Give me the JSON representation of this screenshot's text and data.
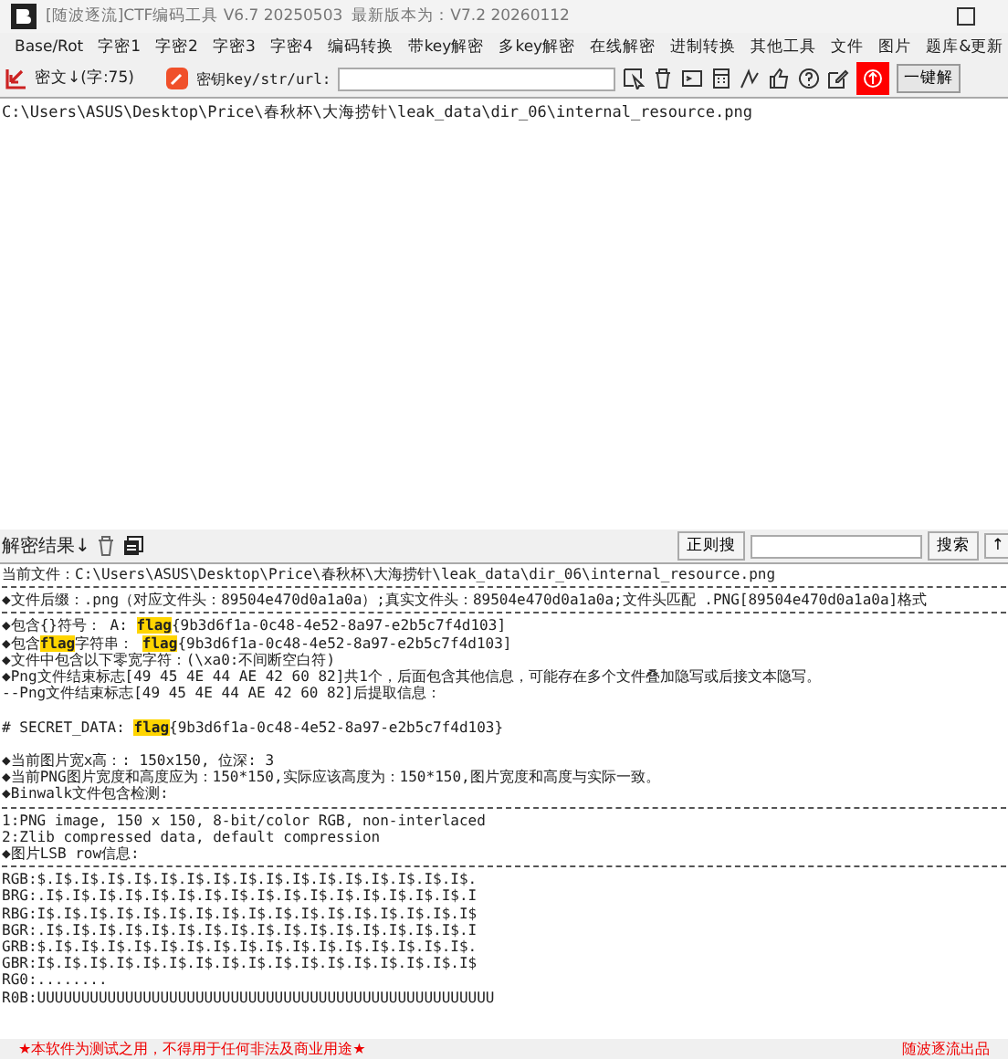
{
  "window": {
    "title": "[随波逐流]CTF编码工具 V6.7 20250503",
    "update_note": "最新版本为：V7.2  20260112"
  },
  "menu": [
    "Base/Rot",
    "字密1",
    "字密2",
    "字密3",
    "字密4",
    "编码转换",
    "带key解密",
    "多key解密",
    "在线解密",
    "进制转换",
    "其他工具",
    "文件",
    "图片",
    "题库&更新"
  ],
  "toolbar": {
    "cipher_label": "密文↓(字:75)",
    "key_label": "密钥key/str/url:",
    "decode_button": "一键解"
  },
  "input_text": "C:\\Users\\ASUS\\Desktop\\Price\\春秋杯\\大海捞针\\leak_data\\dir_06\\internal_resource.png",
  "result_bar": {
    "label": "解密结果↓",
    "regex_button": "正则搜",
    "search_button": "搜索",
    "arrow_button": "↑"
  },
  "output": [
    {
      "kind": "text",
      "text": "当前文件：C:\\Users\\ASUS\\Desktop\\Price\\春秋杯\\大海捞针\\leak_data\\dir_06\\internal_resource.png"
    },
    {
      "kind": "rule"
    },
    {
      "kind": "text",
      "text": "◆文件后缀：.png（对应文件头：89504e470d0a1a0a）;真实文件头：89504e470d0a1a0a;文件头匹配 .PNG[89504e470d0a1a0a]格式"
    },
    {
      "kind": "rule"
    },
    {
      "kind": "text",
      "text": "◆包含{}符号： A: **flag**{9b3d6f1a-0c48-4e52-8a97-e2b5c7f4d103]"
    },
    {
      "kind": "text",
      "text": "◆包含**flag**字符串： **flag**{9b3d6f1a-0c48-4e52-8a97-e2b5c7f4d103]"
    },
    {
      "kind": "text",
      "text": "◆文件中包含以下零宽字符：(\\xa0:不间断空白符)"
    },
    {
      "kind": "text",
      "text": "◆Png文件结束标志[49 45 4E 44 AE 42 60 82]共1个，后面包含其他信息，可能存在多个文件叠加隐写或后接文本隐写。"
    },
    {
      "kind": "text",
      "text": "--Png文件结束标志[49 45 4E 44 AE 42 60 82]后提取信息："
    },
    {
      "kind": "blank"
    },
    {
      "kind": "text",
      "text": "# SECRET_DATA: **flag**{9b3d6f1a-0c48-4e52-8a97-e2b5c7f4d103}"
    },
    {
      "kind": "blank"
    },
    {
      "kind": "text",
      "text": "◆当前图片宽x高：: 150x150, 位深: 3"
    },
    {
      "kind": "text",
      "text": "◆当前PNG图片宽度和高度应为：150*150,实际应该高度为：150*150,图片宽度和高度与实际一致。"
    },
    {
      "kind": "text",
      "text": "◆Binwalk文件包含检测:"
    },
    {
      "kind": "rule"
    },
    {
      "kind": "text",
      "text": "1:PNG image, 150 x 150, 8-bit/color RGB, non-interlaced"
    },
    {
      "kind": "text",
      "text": "2:Zlib compressed data, default compression"
    },
    {
      "kind": "text",
      "text": "◆图片LSB row信息:"
    },
    {
      "kind": "rule"
    },
    {
      "kind": "text",
      "text": "RGB:$.I$.I$.I$.I$.I$.I$.I$.I$.I$.I$.I$.I$.I$.I$.I$.I$."
    },
    {
      "kind": "text",
      "text": "BRG:.I$.I$.I$.I$.I$.I$.I$.I$.I$.I$.I$.I$.I$.I$.I$.I$.I"
    },
    {
      "kind": "text",
      "text": "RBG:I$.I$.I$.I$.I$.I$.I$.I$.I$.I$.I$.I$.I$.I$.I$.I$.I$"
    },
    {
      "kind": "text",
      "text": "BGR:.I$.I$.I$.I$.I$.I$.I$.I$.I$.I$.I$.I$.I$.I$.I$.I$.I"
    },
    {
      "kind": "text",
      "text": "GRB:$.I$.I$.I$.I$.I$.I$.I$.I$.I$.I$.I$.I$.I$.I$.I$.I$."
    },
    {
      "kind": "text",
      "text": "GBR:I$.I$.I$.I$.I$.I$.I$.I$.I$.I$.I$.I$.I$.I$.I$.I$.I$"
    },
    {
      "kind": "text",
      "text": "RG0:........"
    },
    {
      "kind": "text",
      "text": "R0B:UUUUUUUUUUUUUUUUUUUUUUUUUUUUUUUUUUUUUUUUUUUUUUUUUUUU"
    }
  ],
  "status_bar": {
    "notice": "★本软件为测试之用，不得用于任何非法及商业用途★",
    "credit": "随波逐流出品"
  }
}
